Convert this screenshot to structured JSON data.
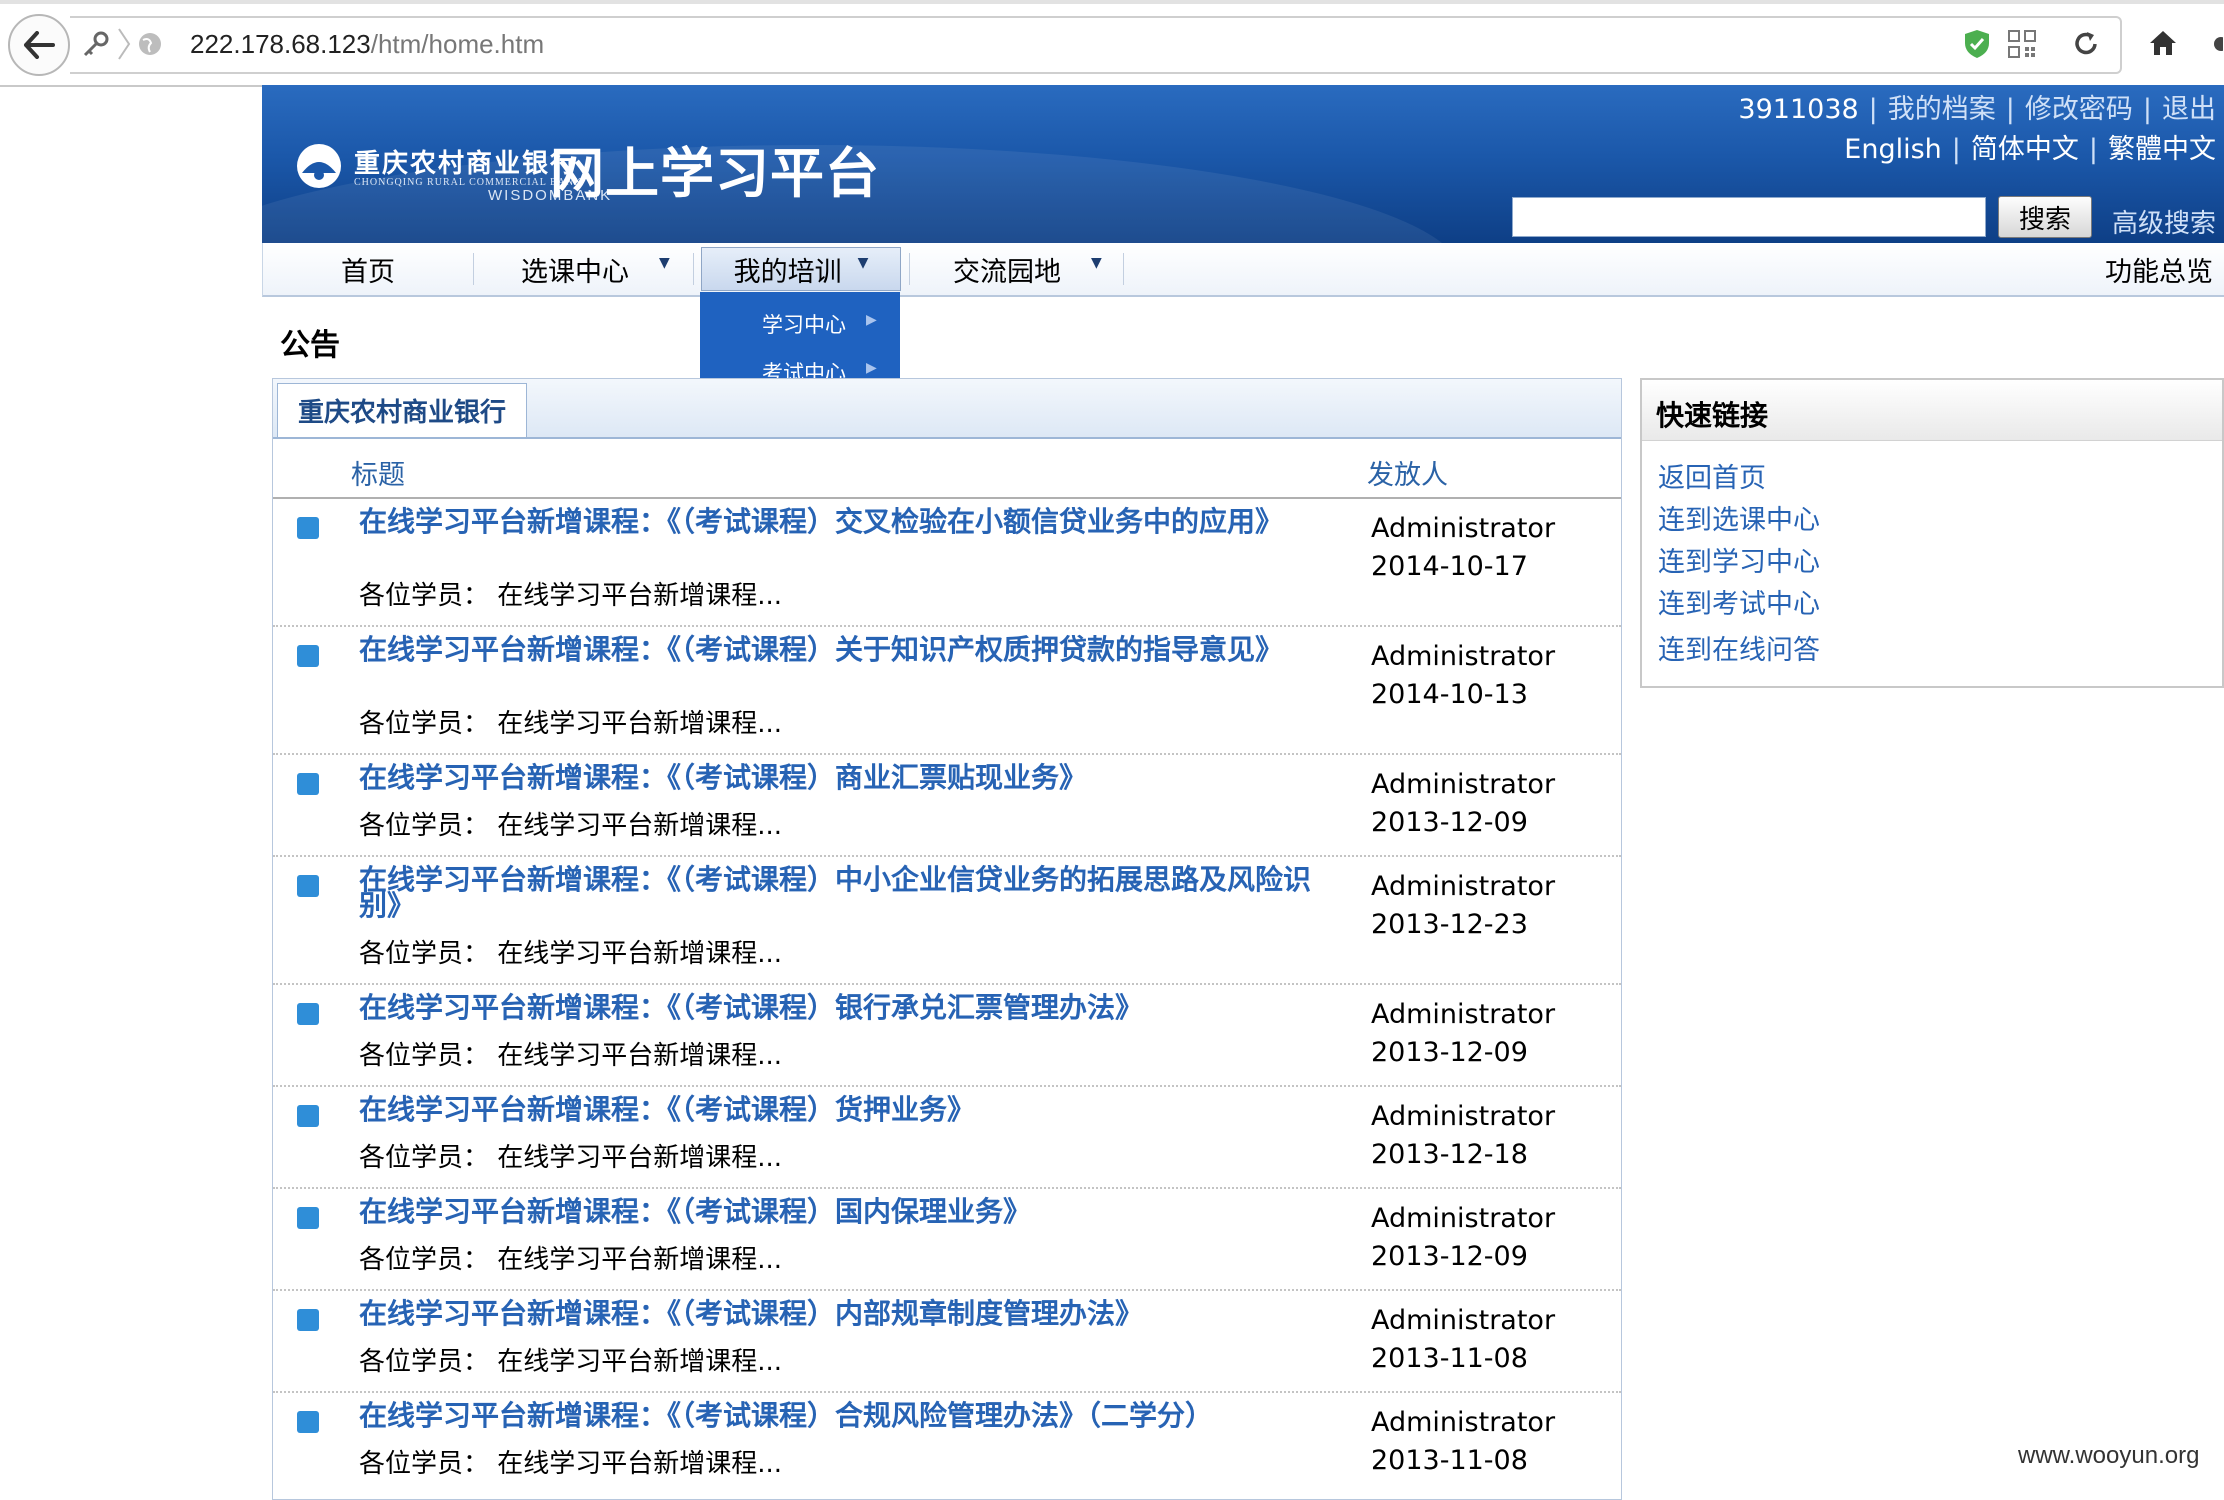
{
  "browser": {
    "url_host": "222.178.68.123",
    "url_path": "/htm/home.htm"
  },
  "header": {
    "bank_name_cn": "重庆农村商业银行",
    "bank_name_en": "CHONGQING RURAL COMMERCIAL BANK",
    "brand": "WISDOMBANK",
    "platform_title": "网上学习平台",
    "user_id": "3911038",
    "user_links": [
      "我的档案",
      "修改密码",
      "退出"
    ],
    "languages": [
      "English",
      "简体中文",
      "繁體中文"
    ],
    "search_button": "搜索",
    "advanced_search": "高级搜索"
  },
  "nav": {
    "items": [
      "首页",
      "选课中心",
      "我的培训",
      "交流园地"
    ],
    "right_item": "功能总览",
    "dropdown": [
      "学习中心",
      "考试中心"
    ]
  },
  "page": {
    "heading": "公告",
    "tab": "重庆农村商业银行",
    "col_title": "标题",
    "col_sender": "发放人"
  },
  "announcements": [
    {
      "title": "在线学习平台新增课程：《（考试课程）交叉检验在小额信贷业务中的应用》",
      "summary": "各位学员：  在线学习平台新增课程...",
      "sender": "Administrator",
      "date": "2014-10-17"
    },
    {
      "title": "在线学习平台新增课程：《（考试课程）关于知识产权质押贷款的指导意见》",
      "summary": "各位学员：  在线学习平台新增课程...",
      "sender": "Administrator",
      "date": "2014-10-13"
    },
    {
      "title": "在线学习平台新增课程：《（考试课程）商业汇票贴现业务》",
      "summary": "各位学员：  在线学习平台新增课程...",
      "sender": "Administrator",
      "date": "2013-12-09"
    },
    {
      "title": "在线学习平台新增课程：《（考试课程）中小企业信贷业务的拓展思路及风险识别》",
      "summary": "各位学员：  在线学习平台新增课程...",
      "sender": "Administrator",
      "date": "2013-12-23"
    },
    {
      "title": "在线学习平台新增课程：《（考试课程）银行承兑汇票管理办法》",
      "summary": "各位学员：  在线学习平台新增课程...",
      "sender": "Administrator",
      "date": "2013-12-09"
    },
    {
      "title": "在线学习平台新增课程：《（考试课程）货押业务》",
      "summary": "各位学员：  在线学习平台新增课程...",
      "sender": "Administrator",
      "date": "2013-12-18"
    },
    {
      "title": "在线学习平台新增课程：《（考试课程）国内保理业务》",
      "summary": "各位学员：  在线学习平台新增课程...",
      "sender": "Administrator",
      "date": "2013-12-09"
    },
    {
      "title": "在线学习平台新增课程：《（考试课程）内部规章制度管理办法》",
      "summary": "各位学员：  在线学习平台新增课程...",
      "sender": "Administrator",
      "date": "2013-11-08"
    },
    {
      "title": "在线学习平台新增课程：《（考试课程）合规风险管理办法》（二学分）",
      "summary": "各位学员：  在线学习平台新增课程...",
      "sender": "Administrator",
      "date": "2013-11-08"
    }
  ],
  "quick_links": {
    "title": "快速链接",
    "items": [
      "返回首页",
      "连到选课中心",
      "连到学习中心",
      "连到考试中心",
      "连到在线问答"
    ]
  },
  "watermark": "www.wooyun.org",
  "colors": {
    "header_blue": "#1b58aa",
    "link_blue": "#2763b4",
    "dropdown_blue": "#1f62c0"
  }
}
